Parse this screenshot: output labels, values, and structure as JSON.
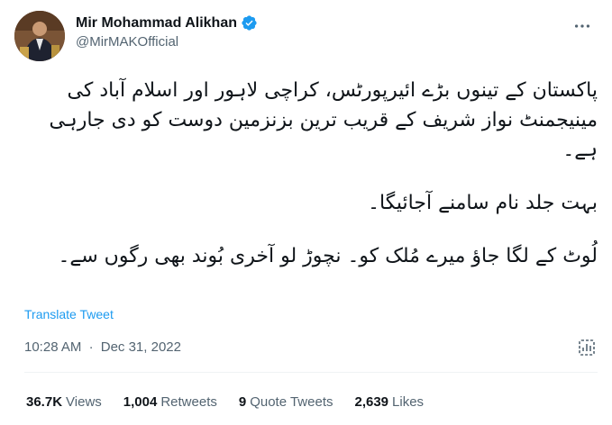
{
  "author": {
    "display_name": "Mir Mohammad Alikhan",
    "handle": "@MirMAKOfficial"
  },
  "tweet": {
    "paragraphs": [
      "پاکستان کے تینوں بڑے ائیرپورٹس، کراچی لاہور اور اسلام آباد کی مینیجمنٹ نواز شریف کے قریب ترین بزنزمین دوست کو دی جارہی ہے۔",
      "بہت جلد نام سامنے آجائیگا۔",
      "لُوٹ کے لگا جاؤ میرے مُلک کو۔ نچوڑ لو آخری بُوند بھی رگوں سے۔"
    ],
    "translate_label": "Translate Tweet",
    "time": "10:28 AM",
    "separator": "·",
    "date": "Dec 31, 2022"
  },
  "stats": {
    "views_count": "36.7K",
    "views_label": "Views",
    "retweets_count": "1,004",
    "retweets_label": "Retweets",
    "quotes_count": "9",
    "quotes_label": "Quote Tweets",
    "likes_count": "2,639",
    "likes_label": "Likes"
  },
  "colors": {
    "accent": "#1d9bf0",
    "secondary_text": "#536471",
    "divider": "#eff3f4"
  },
  "icons": [
    "verified-badge-icon",
    "more-options-icon",
    "analytics-icon"
  ]
}
